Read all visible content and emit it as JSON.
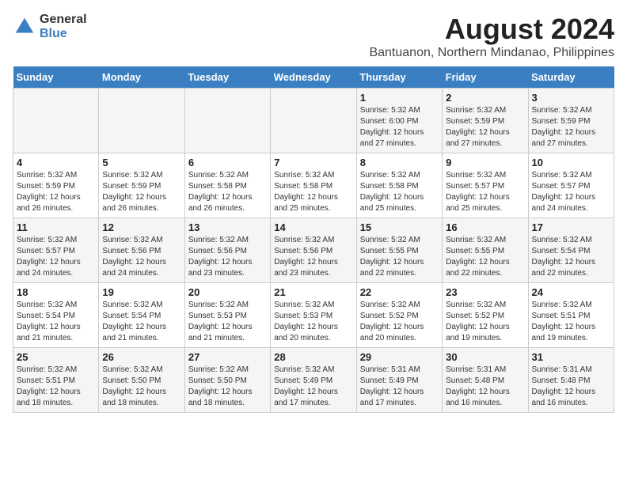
{
  "logo": {
    "general": "General",
    "blue": "Blue"
  },
  "title": "August 2024",
  "subtitle": "Bantuanon, Northern Mindanao, Philippines",
  "days_header": [
    "Sunday",
    "Monday",
    "Tuesday",
    "Wednesday",
    "Thursday",
    "Friday",
    "Saturday"
  ],
  "weeks": [
    [
      {
        "day": "",
        "info": ""
      },
      {
        "day": "",
        "info": ""
      },
      {
        "day": "",
        "info": ""
      },
      {
        "day": "",
        "info": ""
      },
      {
        "day": "1",
        "info": "Sunrise: 5:32 AM\nSunset: 6:00 PM\nDaylight: 12 hours and 27 minutes."
      },
      {
        "day": "2",
        "info": "Sunrise: 5:32 AM\nSunset: 5:59 PM\nDaylight: 12 hours and 27 minutes."
      },
      {
        "day": "3",
        "info": "Sunrise: 5:32 AM\nSunset: 5:59 PM\nDaylight: 12 hours and 27 minutes."
      }
    ],
    [
      {
        "day": "4",
        "info": "Sunrise: 5:32 AM\nSunset: 5:59 PM\nDaylight: 12 hours and 26 minutes."
      },
      {
        "day": "5",
        "info": "Sunrise: 5:32 AM\nSunset: 5:59 PM\nDaylight: 12 hours and 26 minutes."
      },
      {
        "day": "6",
        "info": "Sunrise: 5:32 AM\nSunset: 5:58 PM\nDaylight: 12 hours and 26 minutes."
      },
      {
        "day": "7",
        "info": "Sunrise: 5:32 AM\nSunset: 5:58 PM\nDaylight: 12 hours and 25 minutes."
      },
      {
        "day": "8",
        "info": "Sunrise: 5:32 AM\nSunset: 5:58 PM\nDaylight: 12 hours and 25 minutes."
      },
      {
        "day": "9",
        "info": "Sunrise: 5:32 AM\nSunset: 5:57 PM\nDaylight: 12 hours and 25 minutes."
      },
      {
        "day": "10",
        "info": "Sunrise: 5:32 AM\nSunset: 5:57 PM\nDaylight: 12 hours and 24 minutes."
      }
    ],
    [
      {
        "day": "11",
        "info": "Sunrise: 5:32 AM\nSunset: 5:57 PM\nDaylight: 12 hours and 24 minutes."
      },
      {
        "day": "12",
        "info": "Sunrise: 5:32 AM\nSunset: 5:56 PM\nDaylight: 12 hours and 24 minutes."
      },
      {
        "day": "13",
        "info": "Sunrise: 5:32 AM\nSunset: 5:56 PM\nDaylight: 12 hours and 23 minutes."
      },
      {
        "day": "14",
        "info": "Sunrise: 5:32 AM\nSunset: 5:56 PM\nDaylight: 12 hours and 23 minutes."
      },
      {
        "day": "15",
        "info": "Sunrise: 5:32 AM\nSunset: 5:55 PM\nDaylight: 12 hours and 22 minutes."
      },
      {
        "day": "16",
        "info": "Sunrise: 5:32 AM\nSunset: 5:55 PM\nDaylight: 12 hours and 22 minutes."
      },
      {
        "day": "17",
        "info": "Sunrise: 5:32 AM\nSunset: 5:54 PM\nDaylight: 12 hours and 22 minutes."
      }
    ],
    [
      {
        "day": "18",
        "info": "Sunrise: 5:32 AM\nSunset: 5:54 PM\nDaylight: 12 hours and 21 minutes."
      },
      {
        "day": "19",
        "info": "Sunrise: 5:32 AM\nSunset: 5:54 PM\nDaylight: 12 hours and 21 minutes."
      },
      {
        "day": "20",
        "info": "Sunrise: 5:32 AM\nSunset: 5:53 PM\nDaylight: 12 hours and 21 minutes."
      },
      {
        "day": "21",
        "info": "Sunrise: 5:32 AM\nSunset: 5:53 PM\nDaylight: 12 hours and 20 minutes."
      },
      {
        "day": "22",
        "info": "Sunrise: 5:32 AM\nSunset: 5:52 PM\nDaylight: 12 hours and 20 minutes."
      },
      {
        "day": "23",
        "info": "Sunrise: 5:32 AM\nSunset: 5:52 PM\nDaylight: 12 hours and 19 minutes."
      },
      {
        "day": "24",
        "info": "Sunrise: 5:32 AM\nSunset: 5:51 PM\nDaylight: 12 hours and 19 minutes."
      }
    ],
    [
      {
        "day": "25",
        "info": "Sunrise: 5:32 AM\nSunset: 5:51 PM\nDaylight: 12 hours and 18 minutes."
      },
      {
        "day": "26",
        "info": "Sunrise: 5:32 AM\nSunset: 5:50 PM\nDaylight: 12 hours and 18 minutes."
      },
      {
        "day": "27",
        "info": "Sunrise: 5:32 AM\nSunset: 5:50 PM\nDaylight: 12 hours and 18 minutes."
      },
      {
        "day": "28",
        "info": "Sunrise: 5:32 AM\nSunset: 5:49 PM\nDaylight: 12 hours and 17 minutes."
      },
      {
        "day": "29",
        "info": "Sunrise: 5:31 AM\nSunset: 5:49 PM\nDaylight: 12 hours and 17 minutes."
      },
      {
        "day": "30",
        "info": "Sunrise: 5:31 AM\nSunset: 5:48 PM\nDaylight: 12 hours and 16 minutes."
      },
      {
        "day": "31",
        "info": "Sunrise: 5:31 AM\nSunset: 5:48 PM\nDaylight: 12 hours and 16 minutes."
      }
    ]
  ]
}
